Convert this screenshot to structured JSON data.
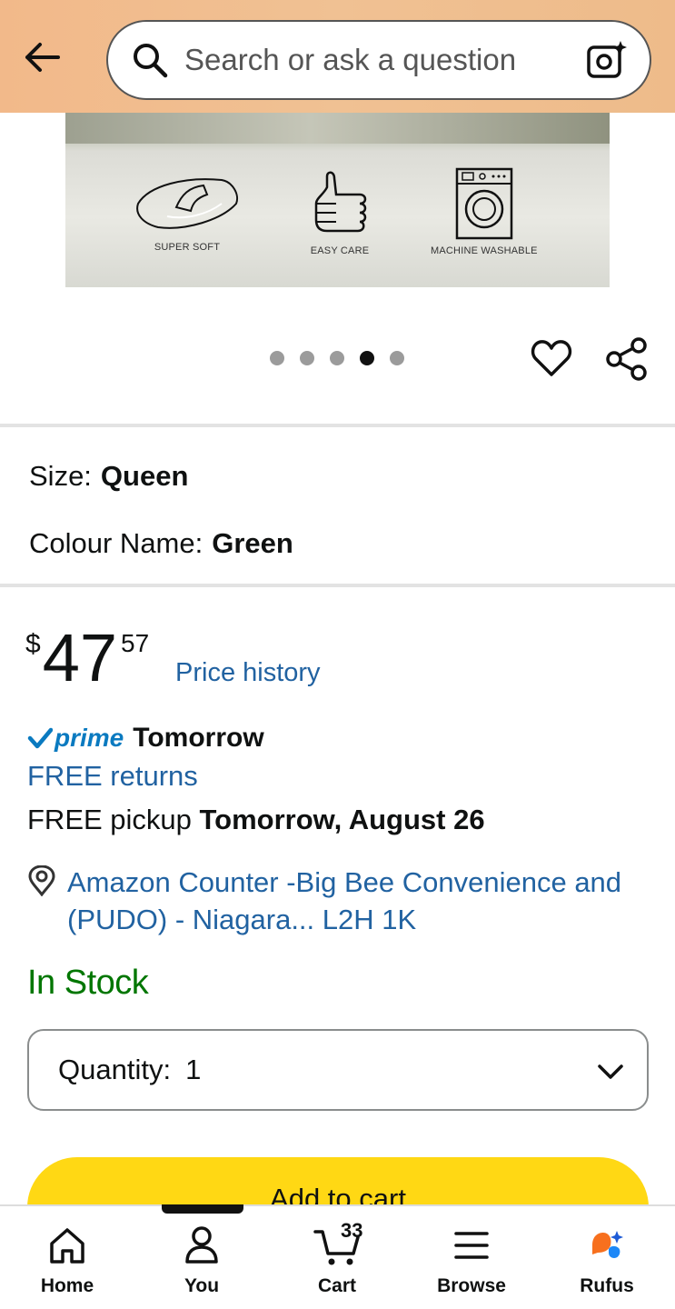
{
  "header": {
    "search_placeholder": "Search or ask a question",
    "icons": {
      "back": "arrow-left-icon",
      "search": "search-icon",
      "camera": "camera-icon"
    }
  },
  "product_image": {
    "features": [
      {
        "label": "SUPER SOFT",
        "icon": "hand-pillow-icon"
      },
      {
        "label": "EASY CARE",
        "icon": "thumbs-up-icon"
      },
      {
        "label": "MACHINE WASHABLE",
        "icon": "washing-machine-icon"
      }
    ],
    "carousel": {
      "total": 5,
      "active_index": 3
    }
  },
  "actions": {
    "heart": "heart-icon",
    "share": "share-icon"
  },
  "variants": {
    "size_label": "Size:",
    "size_value": "Queen",
    "colour_label": "Colour Name:",
    "colour_value": "Green"
  },
  "price": {
    "currency": "$",
    "whole": "47",
    "fraction": "57",
    "history_link": "Price history"
  },
  "delivery": {
    "prime_label": "prime",
    "prime_when": "Tomorrow",
    "free_returns": "FREE returns",
    "pickup_prefix": "FREE pickup",
    "pickup_date": "Tomorrow, August 26",
    "location": "Amazon Counter -Big Bee Convenience and (PUDO) - Niagara... L2H 1K"
  },
  "stock": {
    "status": "In Stock",
    "color": "#007600"
  },
  "quantity": {
    "label": "Quantity:",
    "value": "1"
  },
  "add_to_cart": {
    "label": "Add to cart",
    "color": "#ffd814"
  },
  "bottom_nav": {
    "items": [
      {
        "label": "Home",
        "icon": "home-icon"
      },
      {
        "label": "You",
        "icon": "person-icon"
      },
      {
        "label": "Cart",
        "icon": "cart-icon"
      },
      {
        "label": "Browse",
        "icon": "menu-icon"
      },
      {
        "label": "Rufus",
        "icon": "rufus-icon"
      }
    ],
    "cart_count": "33",
    "active_index": 1
  },
  "colors": {
    "link": "#2162a1",
    "prime": "#0a7ac0"
  }
}
